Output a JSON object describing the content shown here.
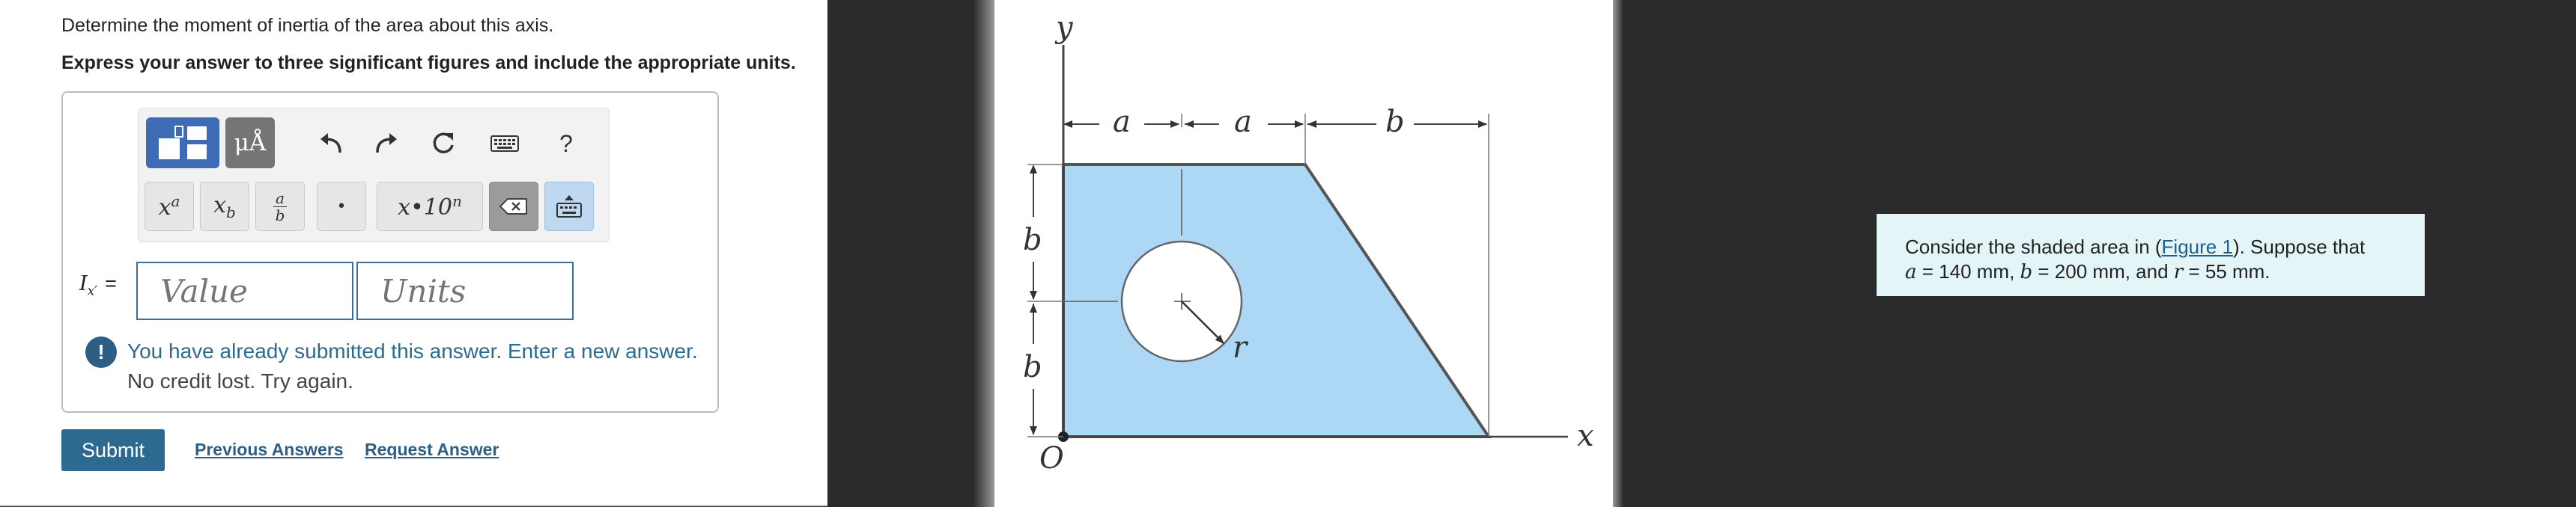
{
  "question": {
    "text": "Determine the moment of inertia of the area about this axis.",
    "instructions": "Express your answer to three significant figures and include the appropriate units."
  },
  "toolbar": {
    "units_label": "μÅ",
    "help_label": "?",
    "superscript_label": "x",
    "superscript_exp": "a",
    "subscript_label": "x",
    "subscript_sub": "b",
    "fraction_num": "a",
    "fraction_den": "b",
    "dot_label": "•",
    "scinot_label": "x•10",
    "scinot_exp": "n",
    "icons": [
      "templates-icon",
      "units-icon",
      "undo-icon",
      "redo-icon",
      "reset-icon",
      "keyboard-icon",
      "help-icon",
      "backspace-icon",
      "keyboard-toggle-icon"
    ]
  },
  "answer": {
    "variable": "I",
    "variable_sub": "x′",
    "equals": "=",
    "value_placeholder": "Value",
    "units_placeholder": "Units"
  },
  "feedback": {
    "icon": "!",
    "line1": "You have already submitted this answer. Enter a new answer.",
    "line2": "No credit lost. Try again."
  },
  "actions": {
    "submit_label": "Submit",
    "previous_answers_label": "Previous Answers",
    "request_answer_label": "Request Answer"
  },
  "figure": {
    "label_y": "y",
    "label_x": "x",
    "label_origin": "O",
    "label_a1": "a",
    "label_a2": "a",
    "label_b_top": "b",
    "label_b_upper": "b",
    "label_b_lower": "b",
    "label_r": "r",
    "fill_color": "#acd8f5"
  },
  "problem": {
    "prefix": "Consider the shaded area in (",
    "figure_link": "Figure 1",
    "suffix": "). Suppose that",
    "a_var": "a",
    "a_val": " = 140 mm, ",
    "b_var": "b",
    "b_val": " = 200 mm, and ",
    "r_var": "r",
    "r_val": " = 55 mm."
  },
  "colors": {
    "accent": "#2e6a90",
    "toolbar_active": "#3e6bb6",
    "feedback": "#2c6b8e",
    "problem_bg": "#e4f5f7"
  }
}
